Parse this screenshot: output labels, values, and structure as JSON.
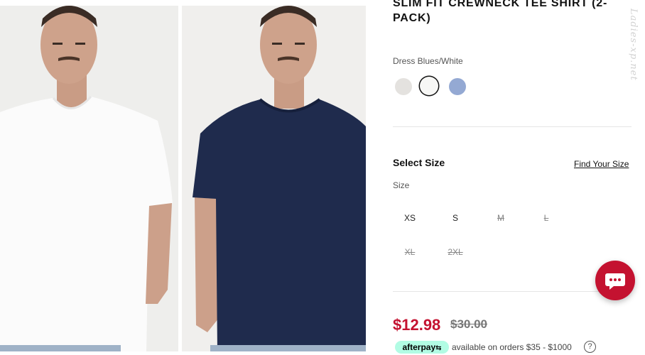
{
  "product": {
    "title": "SLIM FIT CREWNECK TEE SHIRT (2-PACK)",
    "color_name": "Dress Blues/White",
    "swatches": [
      {
        "name": "light-grey",
        "color": "#e4e2df",
        "selected": false
      },
      {
        "name": "white",
        "color": "#f7f7f5",
        "selected": true
      },
      {
        "name": "light-blue",
        "color": "#94a9d3",
        "selected": false
      }
    ]
  },
  "size_section": {
    "heading": "Select Size",
    "find_link": "Find Your Size",
    "label": "Size",
    "sizes": [
      {
        "label": "XS",
        "available": true
      },
      {
        "label": "S",
        "available": true
      },
      {
        "label": "M",
        "available": false
      },
      {
        "label": "L",
        "available": false
      },
      {
        "label": "XL",
        "available": false
      },
      {
        "label": "2XL",
        "available": false
      }
    ]
  },
  "price": {
    "sale": "$12.98",
    "original": "$30.00",
    "sale_color": "#c41230"
  },
  "afterpay": {
    "brand": "afterpay",
    "text": "available on orders $35 - $1000",
    "help_icon": "?"
  },
  "chat": {
    "icon": "chat-bubble-icon",
    "color": "#c41230"
  },
  "watermark": "Ladies-xp.net"
}
